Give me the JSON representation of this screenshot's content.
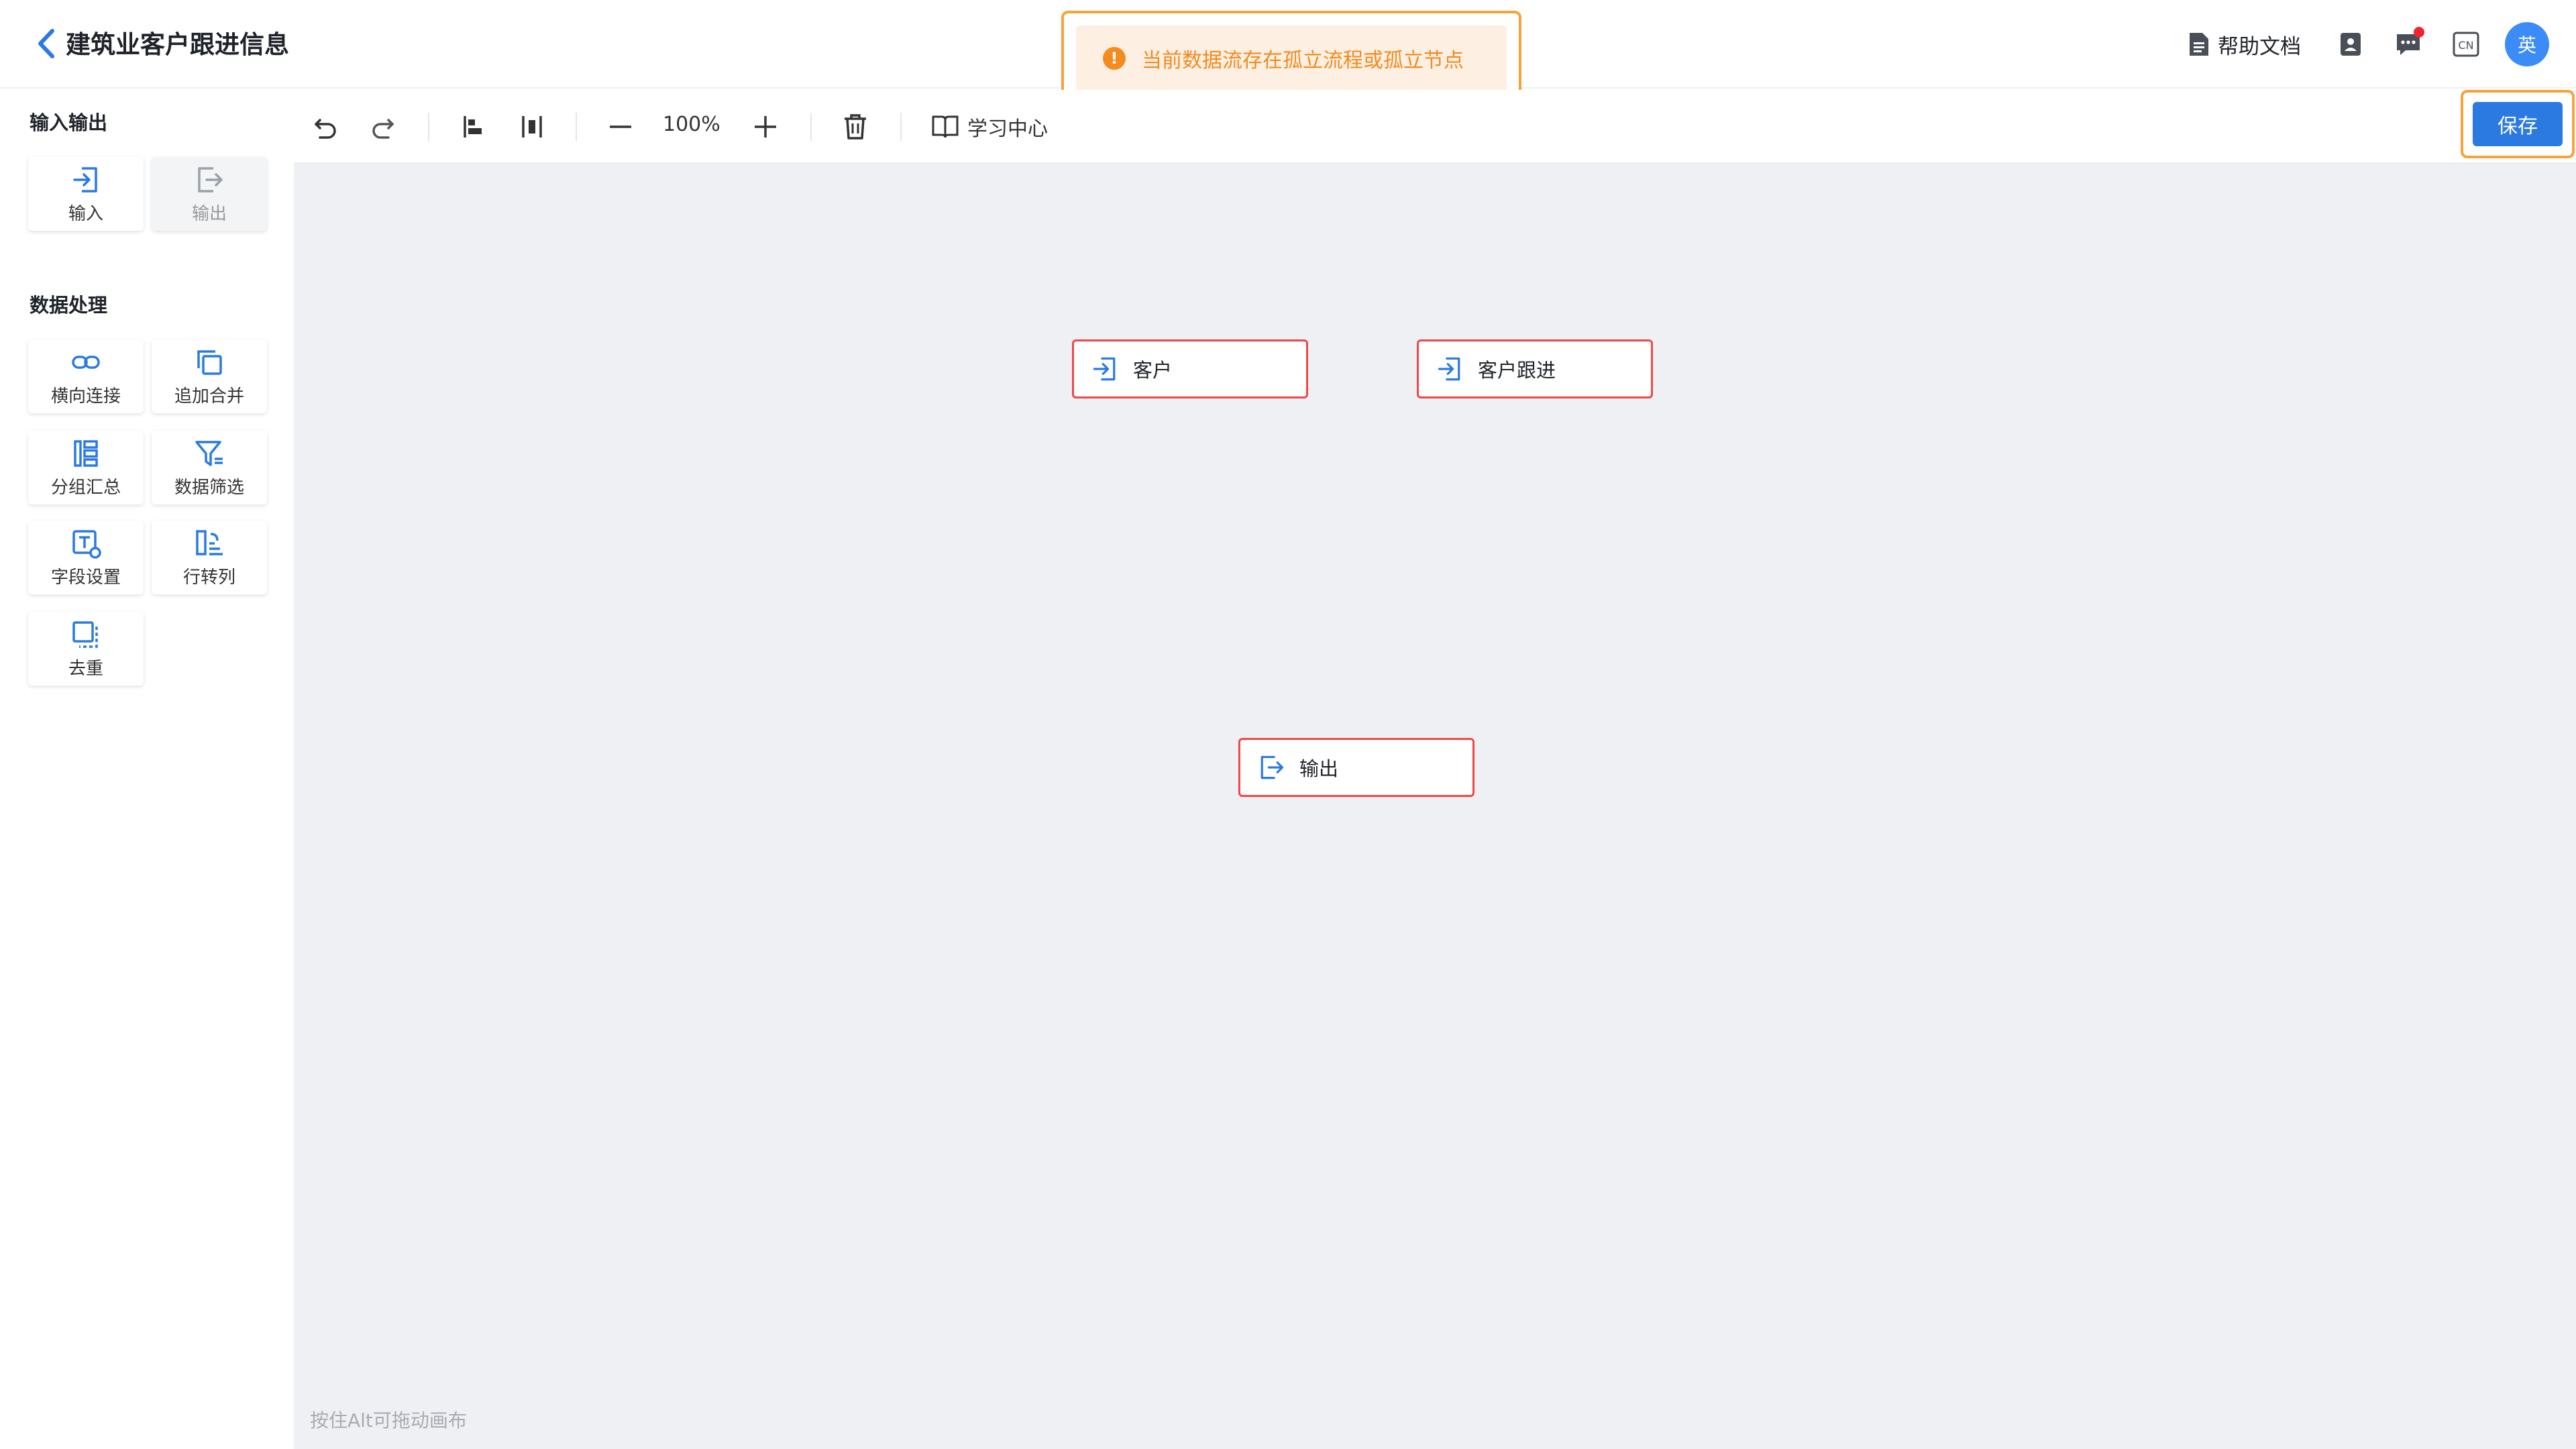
{
  "header": {
    "title": "建筑业客户跟进信息",
    "help_label": "帮助文档",
    "lang_badge": "CN",
    "avatar_text": "英"
  },
  "toast": {
    "message": "当前数据流存在孤立流程或孤立节点"
  },
  "sidebar": {
    "sections": [
      {
        "title": "输入输出",
        "items": [
          {
            "label": "输入",
            "icon": "input-icon",
            "disabled": false
          },
          {
            "label": "输出",
            "icon": "output-icon",
            "disabled": true
          }
        ]
      },
      {
        "title": "数据处理",
        "items": [
          {
            "label": "横向连接",
            "icon": "link-icon"
          },
          {
            "label": "追加合并",
            "icon": "append-icon"
          },
          {
            "label": "分组汇总",
            "icon": "group-icon"
          },
          {
            "label": "数据筛选",
            "icon": "filter-icon"
          },
          {
            "label": "字段设置",
            "icon": "field-settings-icon"
          },
          {
            "label": "行转列",
            "icon": "pivot-icon"
          },
          {
            "label": "去重",
            "icon": "dedupe-icon"
          }
        ]
      }
    ]
  },
  "toolbar": {
    "zoom": "100%",
    "learn_label": "学习中心",
    "save_label": "保存"
  },
  "canvas": {
    "nodes": [
      {
        "label": "客户",
        "type": "input"
      },
      {
        "label": "客户跟进",
        "type": "input"
      },
      {
        "label": "输出",
        "type": "output"
      }
    ],
    "hint": "按住Alt可拖动画布"
  },
  "colors": {
    "primary": "#2a7ae2",
    "warning": "#f58a1f",
    "highlight": "#f8a23c",
    "node_error_border": "#f04747",
    "canvas_bg": "#eef0f3"
  }
}
